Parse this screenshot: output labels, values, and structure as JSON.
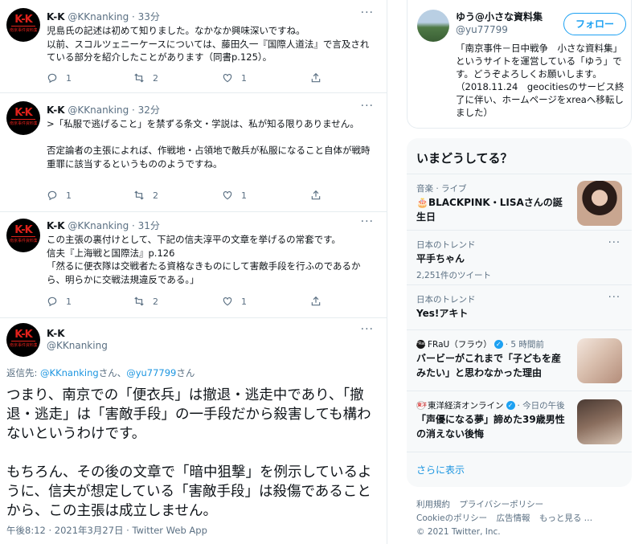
{
  "tweets": [
    {
      "name": "K-K",
      "handle": "@KKnanking",
      "time": "· 33分",
      "text": "児島氏の記述は初めて知りました。なかなか興味深いですね。\n以前、スコルツェニーケースについては、藤田久一『国際人道法』で言及されている部分を紹介したことがあります（同書p.125）。",
      "replies": "1",
      "retweets": "2",
      "likes": "1"
    },
    {
      "name": "K-K",
      "handle": "@KKnanking",
      "time": "· 32分",
      "text": ">「私服で逃げること」を禁ずる条文・学説は、私が知る限りありません。\n\n否定論者の主張によれば、作戦地・占領地で敵兵が私服になること自体が戦時重罪に該当するというもののようですね。",
      "replies": "1",
      "retweets": "2",
      "likes": "1"
    },
    {
      "name": "K-K",
      "handle": "@KKnanking",
      "time": "· 31分",
      "text": "この主張の裏付けとして、下記の信夫淳平の文章を挙げるの常套です。\n信夫『上海戦と国際法』p.126\n「然るに便衣隊は交戦者たる資格なきものにして害敵手段を行ふのであるから、明らかに交戦法規違反である。」",
      "replies": "1",
      "retweets": "2",
      "likes": "1"
    }
  ],
  "avatar": {
    "logo": "K-K",
    "subtext": "南京事件資料集"
  },
  "main_tweet": {
    "name": "K-K",
    "handle": "@KKnanking",
    "reply_prefix": "返信先: ",
    "reply_user1": "@KKnanking",
    "reply_mid": "さん、",
    "reply_user2": "@yu77799",
    "reply_suffix": "さん",
    "text": "つまり、南京での「便衣兵」は撤退・逃走中であり、「撤退・逃走」は「害敵手段」の一手段だから殺害しても構わないというわけです。\n\nもちろん、その後の文章で「暗中狙撃」を例示しているように、信夫が想定している「害敵手段」は殺傷であることから、この主張は成立しません。",
    "meta": "午後8:12 · 2021年3月27日 · Twitter Web App"
  },
  "profile": {
    "name": "ゆう@小さな資料集",
    "handle": "@yu77799",
    "follow_label": "フォロー",
    "bio": "「南京事件－日中戦争　小さな資料集」というサイトを運営している「ゆう」です。どうぞよろしくお願いします。（2018.11.24　geocitiesのサービス終了に伴い、ホームページをxreaへ移転しました）"
  },
  "trends": {
    "title": "いまどうしてる？",
    "items": [
      {
        "category": "音楽 · ライブ",
        "title": "🎂BLACKPINK・LISAさんの誕生日",
        "sub": ""
      },
      {
        "category": "日本のトレンド",
        "title": "平手ちゃん",
        "sub": "2,251件のツイート"
      },
      {
        "category": "日本のトレンド",
        "title": "Yes!アキト",
        "sub": ""
      },
      {
        "source": "FRaU（フラウ）",
        "source_icon": "FRaU",
        "time": "· 5 時間前",
        "title": "バービーがこれまで「子どもを産みたい」と思わなかった理由"
      },
      {
        "source": "東洋経済オンライン",
        "source_icon": "東洋",
        "time": "· 今日の午後",
        "title": "「声優になる夢」諦めた39歳男性の消えない後悔"
      }
    ],
    "show_more": "さらに表示"
  },
  "footer": {
    "links": [
      "利用規約",
      "プライバシーポリシー",
      "Cookieのポリシー",
      "広告情報",
      "もっと見る …"
    ],
    "copyright": "© 2021 Twitter, Inc."
  },
  "colors": {
    "accent": "#1da1f2",
    "link": "#1b95e0",
    "muted": "#5b7083",
    "logo_red": "#e0211b"
  }
}
